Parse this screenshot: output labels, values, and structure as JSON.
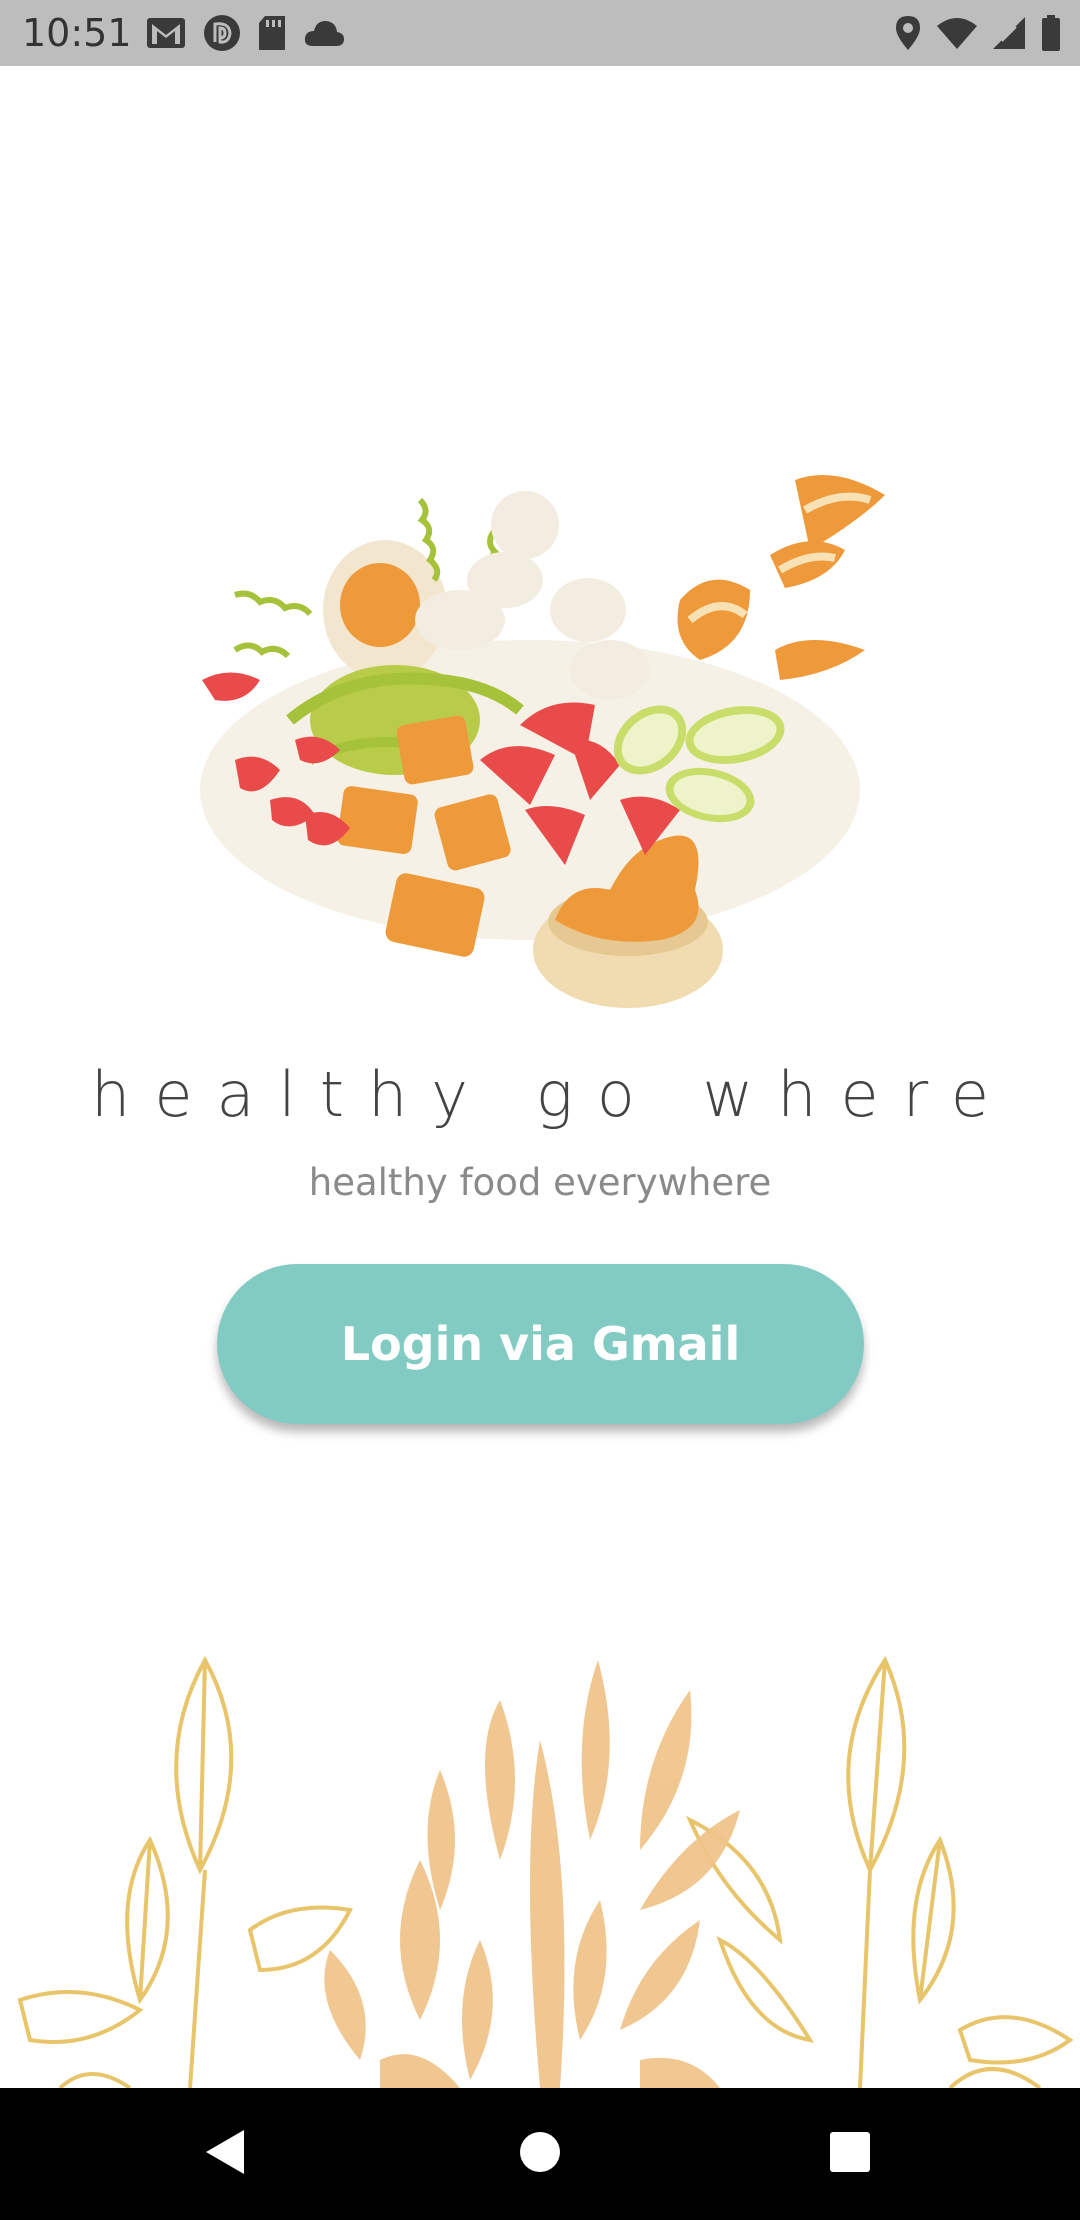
{
  "status_bar": {
    "time": "10:51",
    "left_icons": [
      "gmail-icon",
      "pocketcasts-icon",
      "sd-card-icon",
      "cloud-icon"
    ],
    "right_icons": [
      "location-icon",
      "wifi-icon",
      "signal-icon",
      "battery-icon"
    ]
  },
  "app": {
    "title": "healthy go where",
    "tagline": "healthy food everywhere",
    "login_button_label": "Login via Gmail"
  },
  "colors": {
    "accent": "#82cbc3",
    "title_text": "#444444",
    "tagline_text": "#8a8a8a",
    "status_bar": "#bdbdbd",
    "nav_bar": "#000000"
  },
  "nav_bar": {
    "buttons": [
      "back-icon",
      "home-icon",
      "recents-icon"
    ]
  }
}
